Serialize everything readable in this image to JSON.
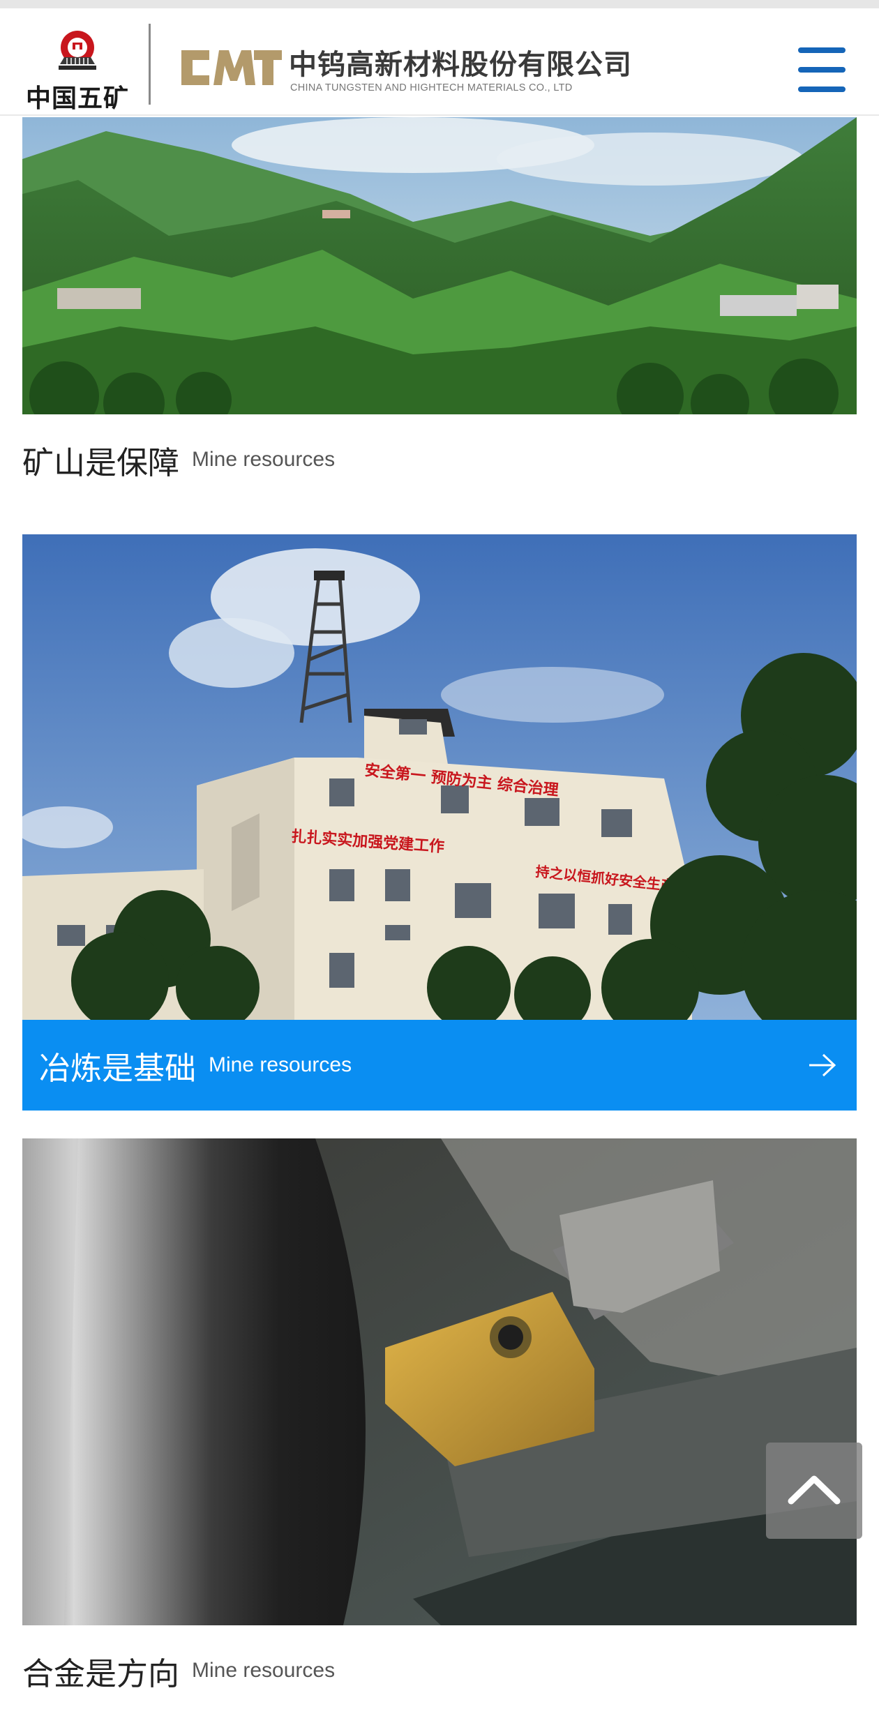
{
  "header": {
    "minmetals_logo_text": "中国五矿",
    "cmt_logo_text": "CMT",
    "company_name_cn": "中钨高新材料股份有限公司",
    "company_name_en": "CHINA TUNGSTEN AND HIGHTECH MATERIALS CO., LTD",
    "menu_icon": "hamburger-icon"
  },
  "sections": [
    {
      "title_cn": "矿山是保障",
      "title_en": "Mine resources",
      "image": "mountain-mine-landscape-photo",
      "active": false
    },
    {
      "title_cn": "冶炼是基础",
      "title_en": "Mine resources",
      "image": "smelting-plant-building-photo",
      "active": true,
      "building_slogan_1": "安全第一 预防为主 综合治理",
      "building_slogan_2": "扎扎实实加强党建工作",
      "building_slogan_3": "持之以恒抓好安全生产",
      "arrow_icon": "arrow-right-icon"
    },
    {
      "title_cn": "合金是方向",
      "title_en": "Mine resources",
      "image": "cutting-tool-insert-photo",
      "active": false
    }
  ],
  "back_to_top_icon": "chevron-up-icon",
  "colors": {
    "accent": "#0a8ef2",
    "menu": "#1565b8",
    "cmt_gold": "#b39a6b",
    "emblem_red": "#c8161d"
  }
}
